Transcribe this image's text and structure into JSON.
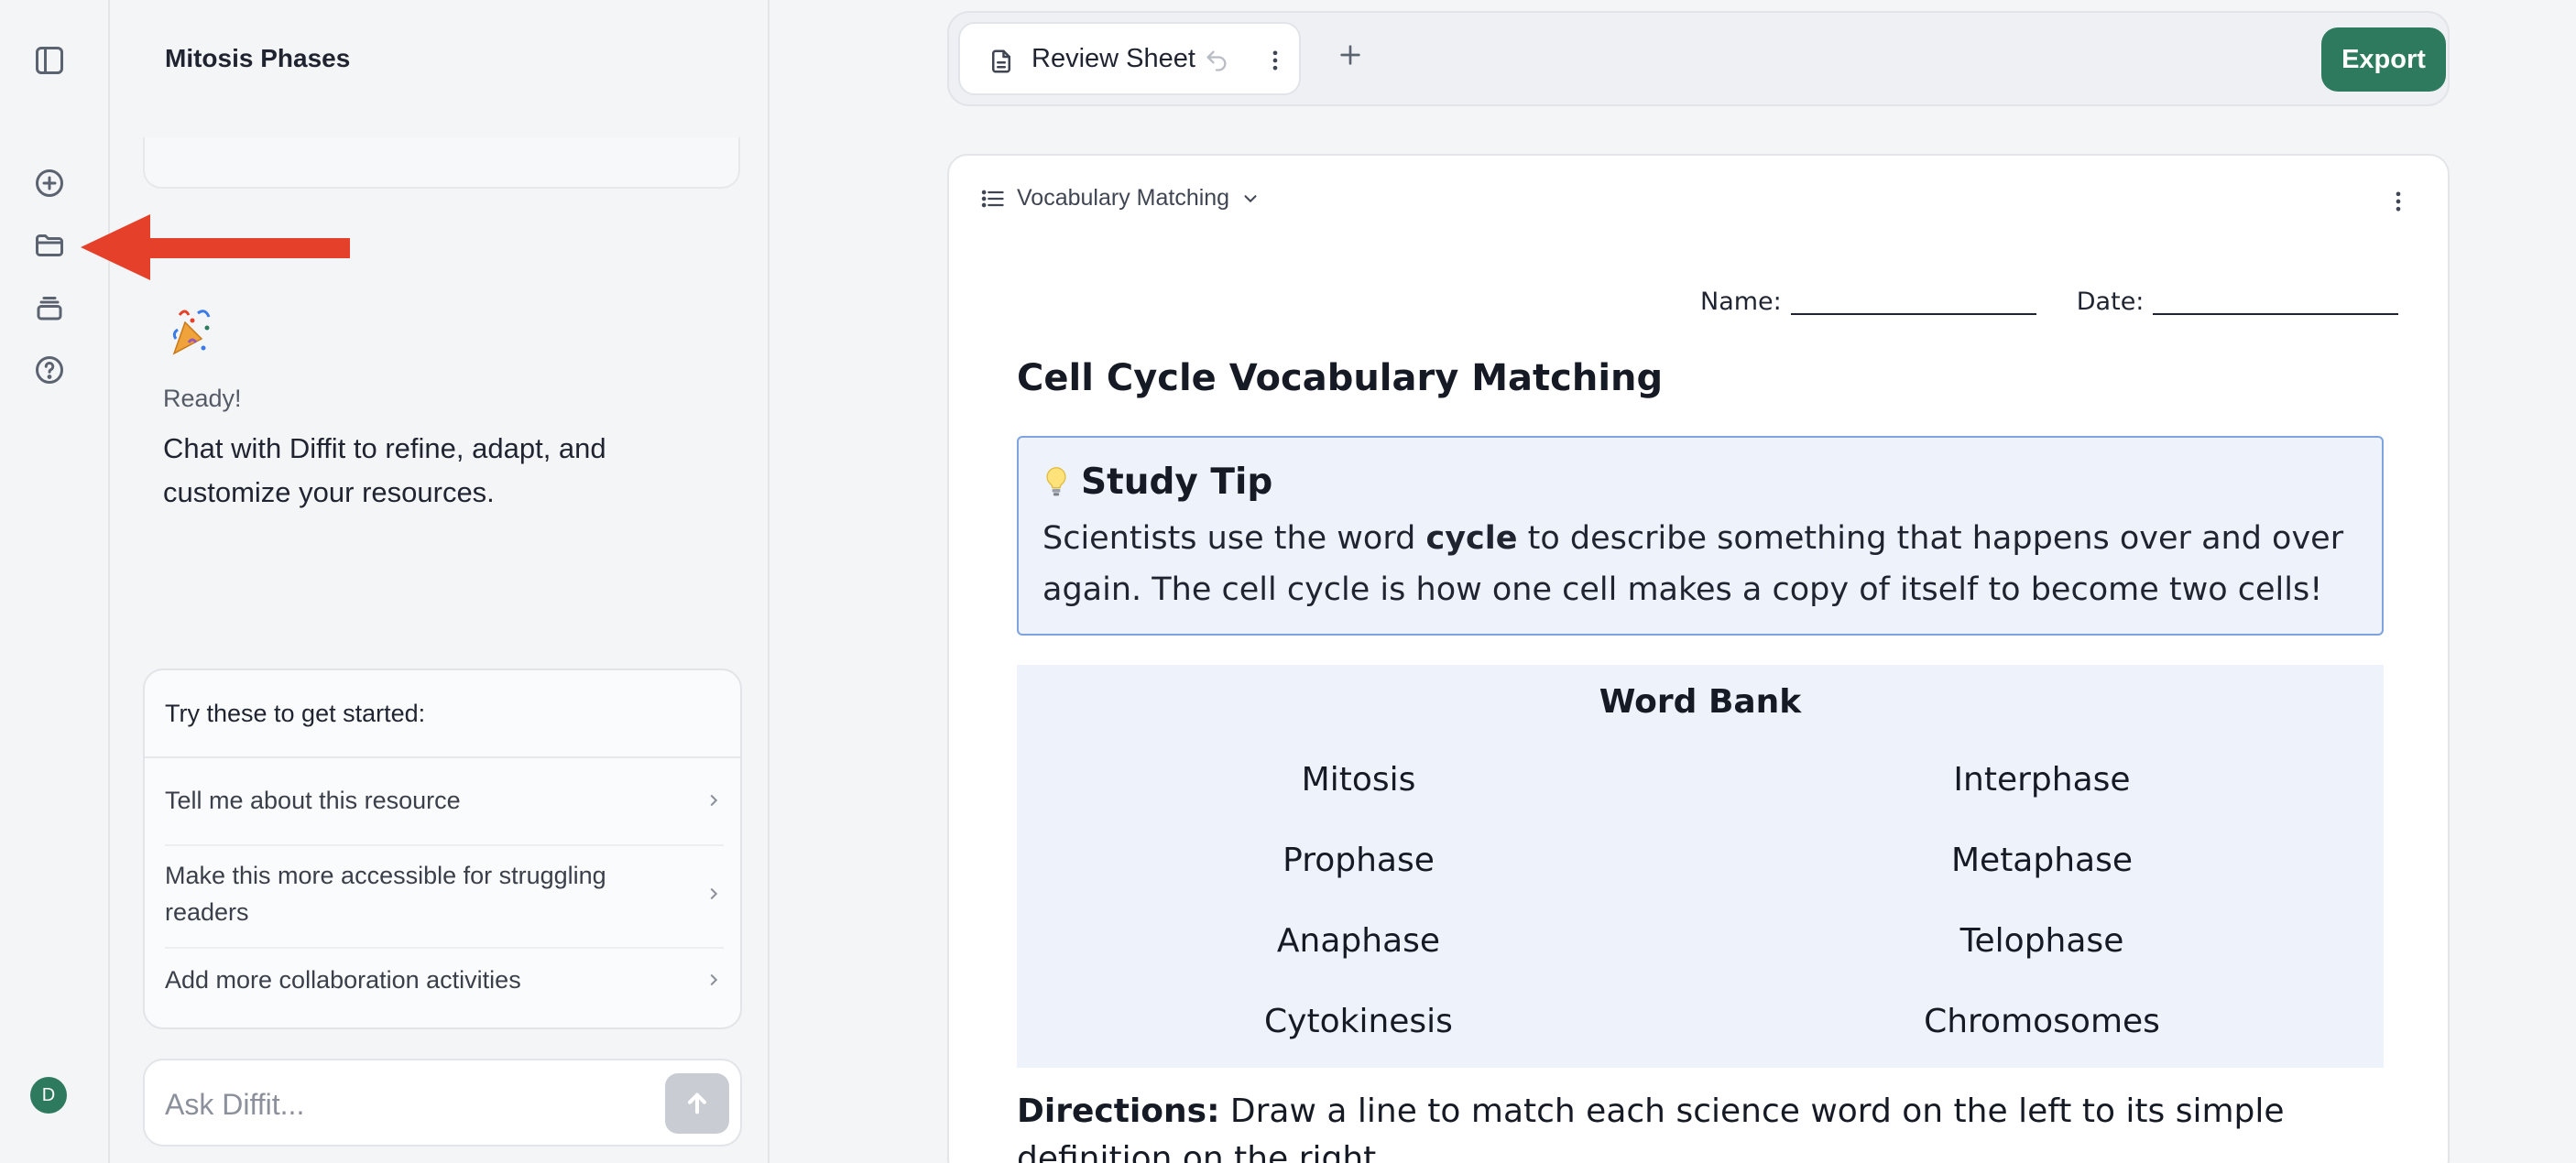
{
  "rail": {
    "avatar_initial": "D"
  },
  "chat": {
    "title": "Mitosis Phases",
    "ready": "Ready!",
    "intro": "Chat with Diffit to refine, adapt, and customize your resources.",
    "suggestions_header": "Try these to get started:",
    "suggestions": [
      {
        "label": "Tell me about this resource"
      },
      {
        "label": "Make this more accessible for struggling readers"
      },
      {
        "label": "Add more collaboration activities"
      }
    ],
    "input_placeholder": "Ask Diffit..."
  },
  "tabs": {
    "active_tab": "Review Sheet",
    "export_label": "Export"
  },
  "document": {
    "section_selector": "Vocabulary Matching",
    "name_label": "Name:",
    "date_label": "Date:",
    "title": "Cell Cycle Vocabulary Matching",
    "tip_title": "Study Tip",
    "tip_before": "Scientists use the word ",
    "tip_bold": "cycle",
    "tip_after": " to describe something that happens over and over again. The cell cycle is how one cell makes a copy of itself to become two cells!",
    "word_bank_title": "Word Bank",
    "word_bank": [
      "Mitosis",
      "Interphase",
      "Prophase",
      "Metaphase",
      "Anaphase",
      "Telophase",
      "Cytokinesis",
      "Chromosomes"
    ],
    "directions_label": "Directions:",
    "directions_text": " Draw a line to match each science word on the left to its simple definition on the right."
  },
  "colors": {
    "accent_green": "#2e7a5e",
    "arrow_red": "#e5402a",
    "tip_border": "#7ea3de",
    "tip_bg": "#eef3fb"
  }
}
